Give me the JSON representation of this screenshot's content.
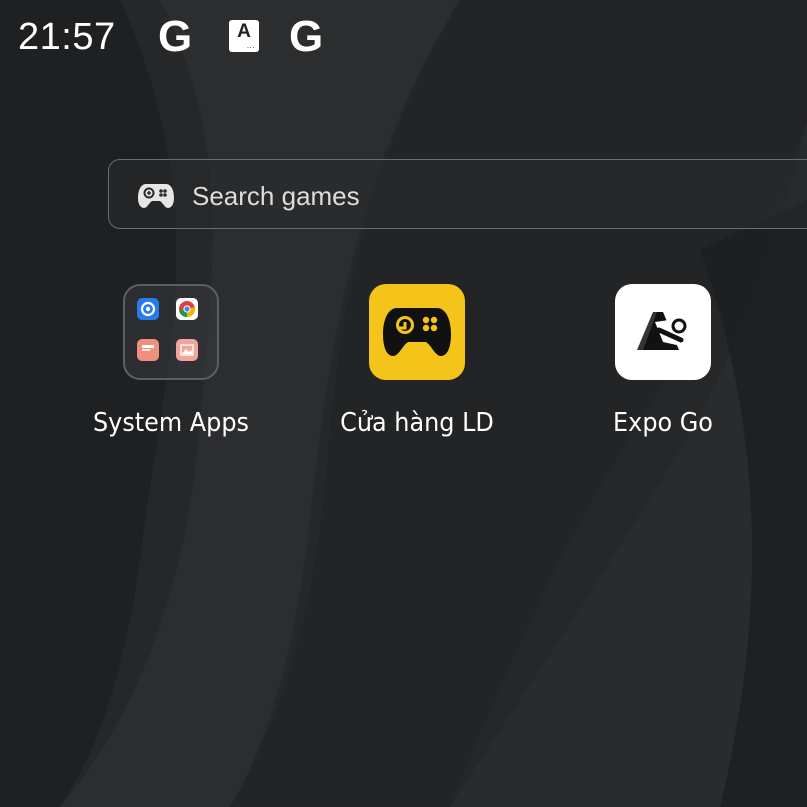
{
  "status_bar": {
    "time": "21:57",
    "icons": [
      "google-icon",
      "accessibility-icon",
      "google-icon"
    ],
    "g_glyph": "G",
    "a_glyph": "A",
    "a_dots": "..."
  },
  "search": {
    "placeholder": "Search games",
    "icon": "gamepad-icon"
  },
  "apps": [
    {
      "label": "System Apps",
      "type": "folder",
      "icons": [
        "settings-icon",
        "chrome-icon",
        "files-icon",
        "gallery-icon"
      ]
    },
    {
      "label": "Cửa hàng LD",
      "type": "app",
      "icon": "ld-store-gamepad-icon",
      "color": "#f5c41b"
    },
    {
      "label": "Expo Go",
      "type": "app",
      "icon": "expo-go-icon",
      "color": "#ffffff"
    }
  ]
}
